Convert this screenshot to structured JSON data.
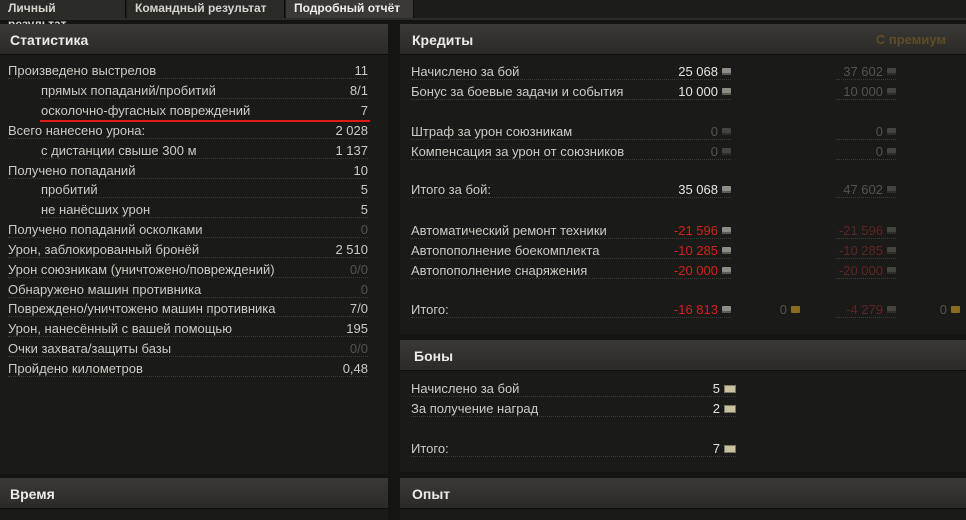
{
  "tabs": [
    "Личный результат",
    "Командный результат",
    "Подробный отчёт"
  ],
  "stats": {
    "title": "Статистика",
    "rows": [
      {
        "label": "Произведено выстрелов",
        "value": "11"
      },
      {
        "label": "прямых попаданий/пробитий",
        "value": "8/1"
      },
      {
        "label": "осколочно-фугасных повреждений",
        "value": "7"
      },
      {
        "label": "Всего нанесено урона:",
        "value": "2 028"
      },
      {
        "label": "с дистанции свыше 300 м",
        "value": "1 137"
      },
      {
        "label": "Получено попаданий",
        "value": "10"
      },
      {
        "label": "пробитий",
        "value": "5"
      },
      {
        "label": "не нанёсших урон",
        "value": "5"
      },
      {
        "label": "Получено попаданий осколками",
        "value": "0"
      },
      {
        "label": "Урон, заблокированный бронёй",
        "value": "2 510"
      },
      {
        "label": "Урон союзникам (уничтожено/повреждений)",
        "value": "0/0"
      },
      {
        "label": "Обнаружено машин противника",
        "value": "0"
      },
      {
        "label": "Повреждено/уничтожено машин противника",
        "value": "7/0"
      },
      {
        "label": "Урон, нанесённый с вашей помощью",
        "value": "195"
      },
      {
        "label": "Очки захвата/защиты базы",
        "value": "0/0"
      },
      {
        "label": "Пройдено километров",
        "value": "0,48"
      }
    ]
  },
  "credits": {
    "title": "Кредиты",
    "premium_label": "С премиум",
    "rows": [
      {
        "label": "Начислено за бой",
        "value": "25 068",
        "premium": "37 602"
      },
      {
        "label": "Бонус за боевые задачи и события",
        "value": "10 000",
        "premium": "10 000"
      },
      {
        "label": "Штраф за урон союзникам",
        "value": "0",
        "premium": "0"
      },
      {
        "label": "Компенсация за урон от союзников",
        "value": "0",
        "premium": "0"
      },
      {
        "label": "Итого за бой:",
        "value": "35 068",
        "premium": "47 602"
      },
      {
        "label": "Автоматический ремонт техники",
        "value": "-21 596",
        "premium": "-21 596"
      },
      {
        "label": "Автопополнение боекомплекта",
        "value": "-10 285",
        "premium": "-10 285"
      },
      {
        "label": "Автопополнение снаряжения",
        "value": "-20 000",
        "premium": "-20 000"
      },
      {
        "label": "Итого:",
        "value": "-16 813",
        "gold": "0",
        "premium": "-4 279",
        "premium_gold": "0"
      }
    ]
  },
  "bonds": {
    "title": "Боны",
    "rows": [
      {
        "label": "Начислено за бой",
        "value": "5"
      },
      {
        "label": "За получение наград",
        "value": "2"
      },
      {
        "label": "Итого:",
        "value": "7"
      }
    ]
  },
  "time": {
    "title": "Время"
  },
  "experience": {
    "title": "Опыт"
  }
}
